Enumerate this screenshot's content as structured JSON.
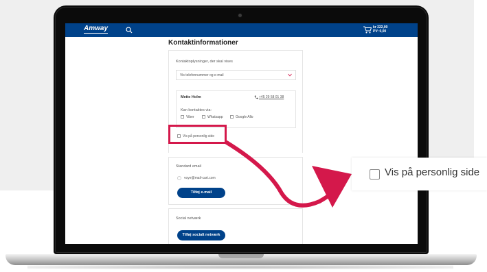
{
  "header": {
    "logo": "Amway",
    "cart_amount": "kr 222,00",
    "cart_pv": "PV: 0,00"
  },
  "page": {
    "title": "Kontaktinformationer"
  },
  "contact": {
    "display_label": "Kontaktoplysninger, der skal vises",
    "dropdown_value": "Vis telefonnummer og e-mail",
    "name": "Mette Holm",
    "phone": "+45 29 58 01 38",
    "reach_label": "Kan kontaktes via:",
    "options": [
      "Viber",
      "Whatsapp",
      "Google Allo"
    ],
    "show_on_page": "Vis på personlig side"
  },
  "email": {
    "section_label": "Standard email",
    "address": "voye@mail-cart.com",
    "add_button": "Tilføj e-mail"
  },
  "social": {
    "section_label": "Social netværk",
    "add_button": "Tilføj socialt netværk"
  },
  "callout": {
    "label": "Vis på personlig side"
  },
  "colors": {
    "brand_blue": "#00428a",
    "highlight": "#d4184b"
  }
}
